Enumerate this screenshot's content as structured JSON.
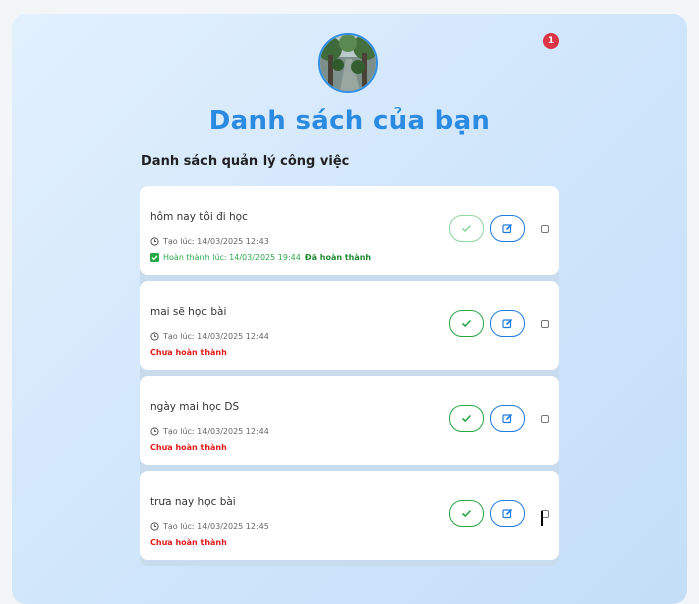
{
  "header": {
    "notification_count": "1",
    "title": "Danh sách của bạn",
    "subtitle": "Danh sách quản lý công việc"
  },
  "tasks": [
    {
      "text": "hôm nay tôi đi học",
      "created": "Tạo lúc: 14/03/2025 12:43",
      "completed": true,
      "done_time": "Hoàn thành lúc: 14/03/2025 19:44",
      "status_label": "Đã hoàn thành"
    },
    {
      "text": "mai sẽ học bài",
      "created": "Tạo lúc: 14/03/2025 12:44",
      "completed": false,
      "status_label": "Chưa hoàn thành"
    },
    {
      "text": "ngày mai học DS",
      "created": "Tạo lúc: 14/03/2025 12:44",
      "completed": false,
      "status_label": "Chưa hoàn thành"
    },
    {
      "text": "trưa nay học bài",
      "created": "Tạo lúc: 14/03/2025 12:45",
      "completed": false,
      "status_label": "Chưa hoàn thành"
    }
  ],
  "colors": {
    "title": "#2b8ae2",
    "complete_green": "#28a745",
    "edit_blue": "#1e7be0",
    "incomplete_red": "#e31818",
    "badge_red": "#dc3545"
  },
  "icons": [
    "clock-icon",
    "check-icon",
    "edit-icon",
    "checkbox-checked-icon",
    "notification-badge"
  ]
}
